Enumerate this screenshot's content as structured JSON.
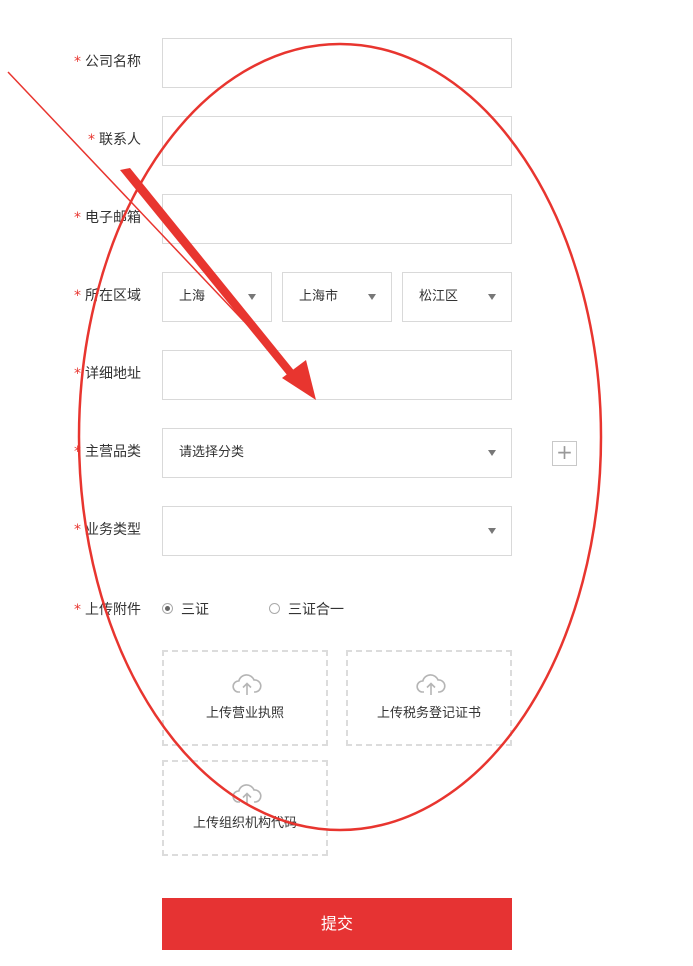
{
  "form": {
    "required_mark": "*",
    "company_name": {
      "label": "公司名称",
      "value": ""
    },
    "contact_person": {
      "label": "联系人",
      "value": ""
    },
    "email": {
      "label": "电子邮箱",
      "value": ""
    },
    "region": {
      "label": "所在区域",
      "province": "上海",
      "city": "上海市",
      "district": "松江区"
    },
    "address": {
      "label": "详细地址",
      "value": ""
    },
    "main_category": {
      "label": "主营品类",
      "selected": "请选择分类",
      "add_symbol": "+"
    },
    "business_type": {
      "label": "业务类型",
      "selected": ""
    },
    "attachments": {
      "label": "上传附件",
      "options": [
        {
          "label": "三证",
          "checked": true
        },
        {
          "label": "三证合一",
          "checked": false
        }
      ],
      "uploads": [
        {
          "label": "上传营业执照",
          "icon": "cloud-upload-icon"
        },
        {
          "label": "上传税务登记证书",
          "icon": "cloud-upload-icon"
        },
        {
          "label": "上传组织机构代码",
          "icon": "cloud-upload-icon"
        }
      ]
    },
    "submit_label": "提交"
  },
  "colors": {
    "accent": "#e63333",
    "annotation": "#e8352f",
    "border": "#d9d9d9"
  }
}
